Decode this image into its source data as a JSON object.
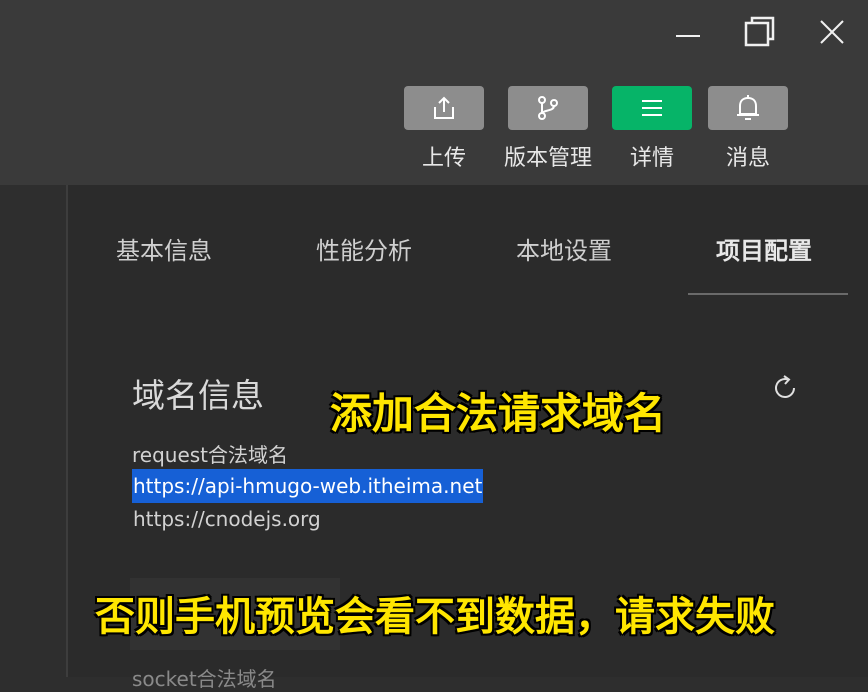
{
  "toolbar": {
    "upload_label": "上传",
    "version_label": "版本管理",
    "detail_label": "详情",
    "message_label": "消息",
    "active_color": "#06b468"
  },
  "tabs": [
    {
      "label": "基本信息"
    },
    {
      "label": "性能分析"
    },
    {
      "label": "本地设置"
    },
    {
      "label": "项目配置"
    }
  ],
  "section": {
    "title": "域名信息",
    "request_label": "request合法域名",
    "domains": [
      "https://api-hmugo-web.itheima.net",
      "https://cnodejs.org"
    ],
    "next_label": "socket合法域名"
  },
  "annotations": {
    "top": "添加合法请求域名",
    "bottom": "否则手机预览会看不到数据，请求失败"
  }
}
